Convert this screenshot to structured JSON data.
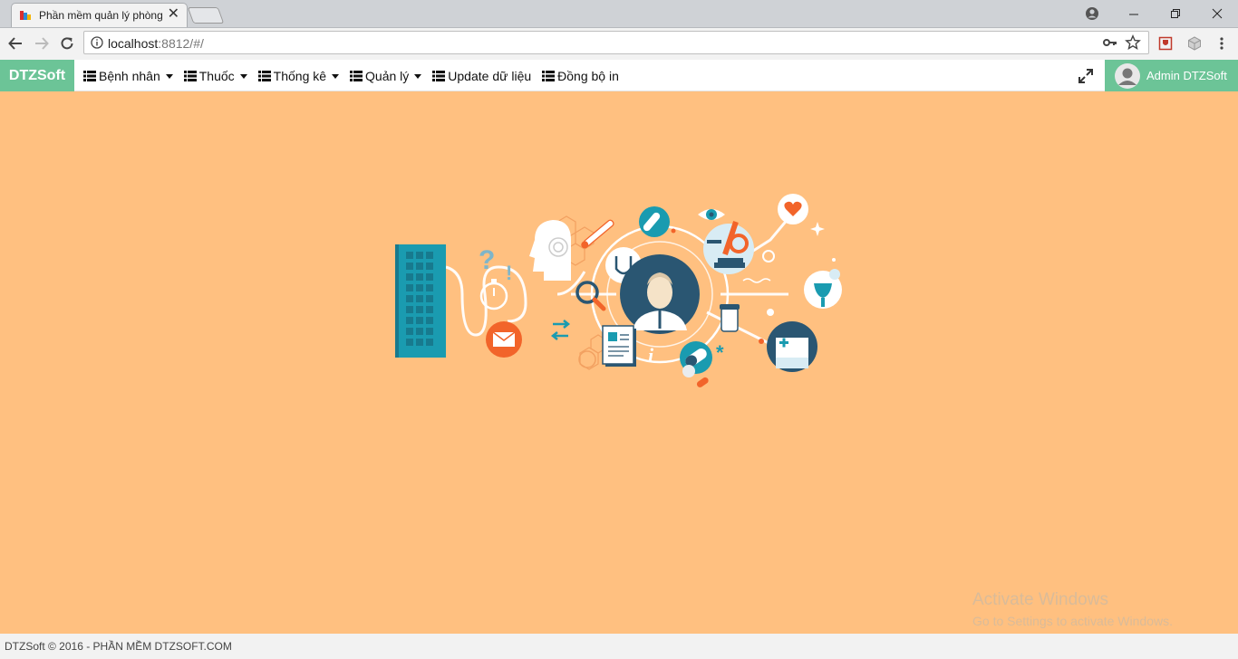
{
  "browser": {
    "tab_title": "Phần mềm quản lý phòng",
    "url_host": "localhost",
    "url_rest": ":8812/#/"
  },
  "app": {
    "brand": "DTZSoft",
    "menu": [
      {
        "label": "Bệnh nhân",
        "dropdown": true
      },
      {
        "label": "Thuốc",
        "dropdown": true
      },
      {
        "label": "Thống kê",
        "dropdown": true
      },
      {
        "label": "Quản lý",
        "dropdown": true
      },
      {
        "label": "Update dữ liệu",
        "dropdown": false
      },
      {
        "label": "Đồng bộ in",
        "dropdown": false
      }
    ],
    "user": "Admin DTZSoft"
  },
  "colors": {
    "background": "#ffc080",
    "brand": "#6cc497",
    "teal": "#1a9bb0",
    "navy": "#2a5672",
    "orange": "#f2642a"
  },
  "watermark": {
    "title": "Activate Windows",
    "subtitle": "Go to Settings to activate Windows."
  },
  "footer": {
    "text": "DTZSoft © 2016 - PHẦN MỀM DTZSOFT.COM"
  }
}
